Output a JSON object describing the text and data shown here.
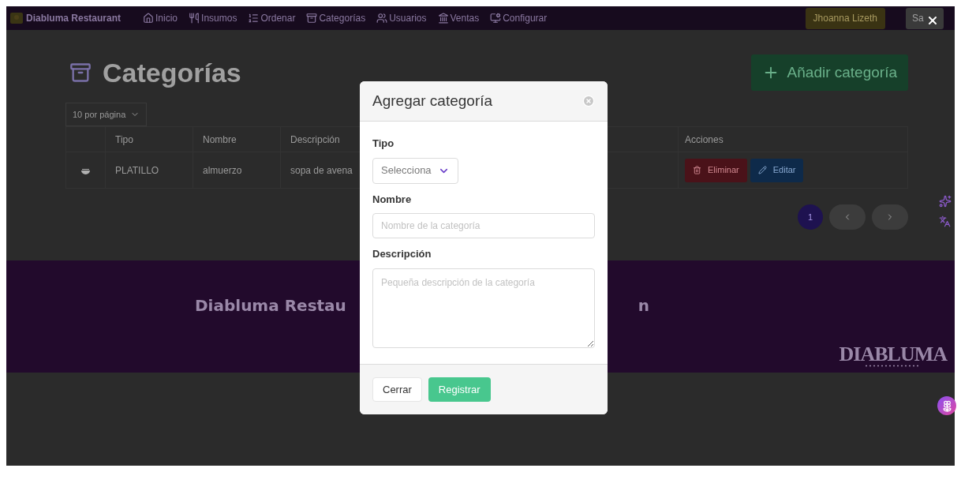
{
  "navbar": {
    "brand": "Diabluma Restaurant",
    "items": [
      {
        "label": "Inicio"
      },
      {
        "label": "Insumos"
      },
      {
        "label": "Ordenar"
      },
      {
        "label": "Categorías"
      },
      {
        "label": "Usuarios"
      },
      {
        "label": "Ventas"
      },
      {
        "label": "Configurar"
      }
    ],
    "user_button": "Jhoanna Lizeth",
    "logout_button": "Sa"
  },
  "page": {
    "title": "Categorías",
    "add_button": "Añadir categoría",
    "per_page": "10 por página"
  },
  "table": {
    "columns": [
      "Tipo",
      "Nombre",
      "Descripción"
    ],
    "actions_column": "Acciones",
    "rows": [
      {
        "tipo": "PLATILLO",
        "nombre": "almuerzo",
        "descripcion": "sopa de avena",
        "actions": [
          "Eliminar",
          "Editar"
        ]
      }
    ]
  },
  "pagination": {
    "pages": [
      {
        "label": "1",
        "selected": true
      }
    ]
  },
  "footer": {
    "title_parts": [
      "Diabluma Restau",
      "n"
    ],
    "logo": "DIABLUMA"
  },
  "modal": {
    "title": "Agregar categoría",
    "fields": [
      {
        "kind": "select",
        "label": "Tipo",
        "value": "Selecciona"
      },
      {
        "kind": "input",
        "label": "Nombre",
        "placeholder": "Nombre de la categoría"
      },
      {
        "kind": "textarea",
        "label": "Descripción",
        "placeholder": "Pequeña descripción de la categoría"
      }
    ],
    "buttons": [
      {
        "label": "Cerrar",
        "kind": "secondary"
      },
      {
        "label": "Registrar",
        "kind": "primary"
      }
    ]
  }
}
